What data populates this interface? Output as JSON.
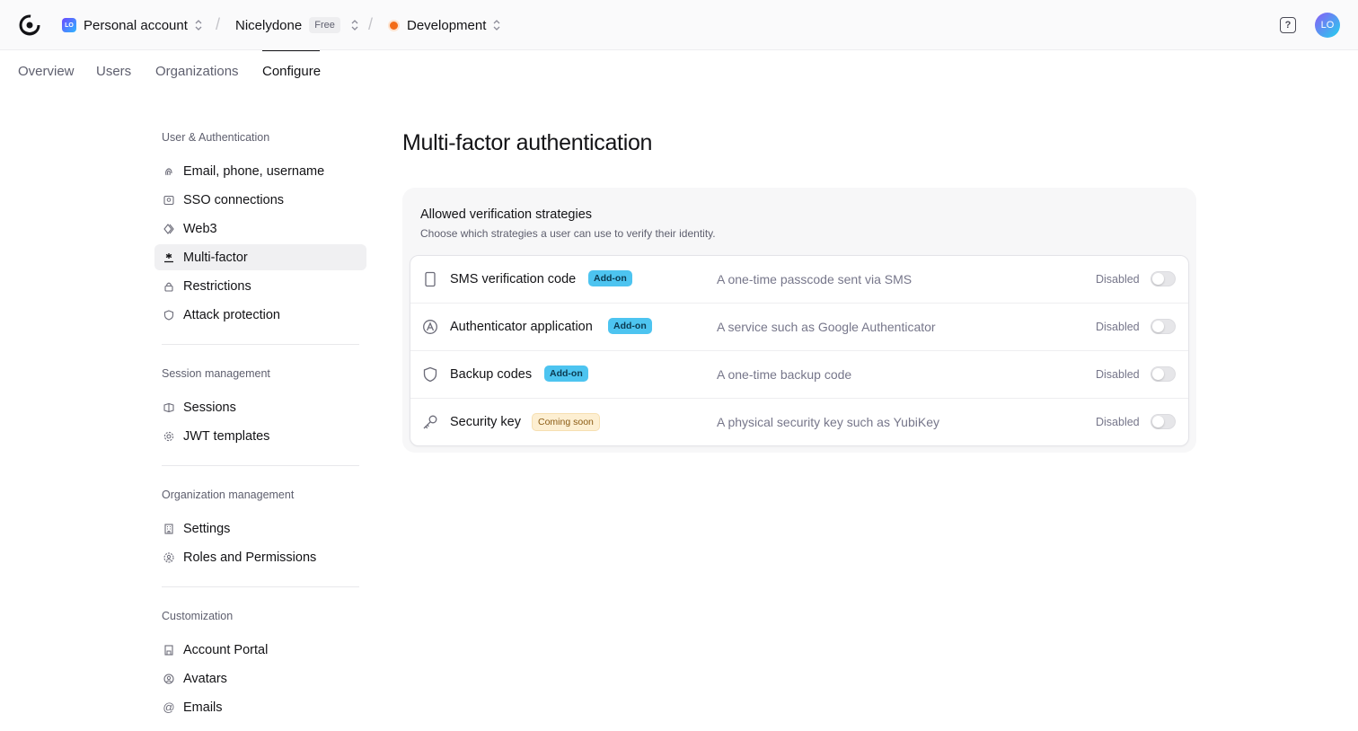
{
  "header": {
    "account": {
      "avatar_text": "LO",
      "label": "Personal account"
    },
    "app": {
      "label": "Nicelydone",
      "plan_badge": "Free"
    },
    "instance": {
      "label": "Development"
    },
    "help_icon": "question-icon",
    "user_avatar": "LO"
  },
  "tabs": [
    {
      "label": "Overview",
      "active": false
    },
    {
      "label": "Users",
      "active": false
    },
    {
      "label": "Organizations",
      "active": false
    },
    {
      "label": "Configure",
      "active": true
    }
  ],
  "sidebar": {
    "sections": [
      {
        "title": "User & Authentication",
        "items": [
          {
            "label": "Email, phone, username",
            "icon": "fingerprint-icon",
            "active": false
          },
          {
            "label": "SSO connections",
            "icon": "sso-icon",
            "active": false
          },
          {
            "label": "Web3",
            "icon": "web3-icon",
            "active": false
          },
          {
            "label": "Multi-factor",
            "icon": "asterisk-icon",
            "active": true
          },
          {
            "label": "Restrictions",
            "icon": "lock-icon",
            "active": false
          },
          {
            "label": "Attack protection",
            "icon": "shield-icon",
            "active": false
          }
        ]
      },
      {
        "title": "Session management",
        "items": [
          {
            "label": "Sessions",
            "icon": "session-icon",
            "active": false
          },
          {
            "label": "JWT templates",
            "icon": "gear-icon",
            "active": false
          }
        ]
      },
      {
        "title": "Organization management",
        "items": [
          {
            "label": "Settings",
            "icon": "building-icon",
            "active": false
          },
          {
            "label": "Roles and Permissions",
            "icon": "roles-icon",
            "active": false
          }
        ]
      },
      {
        "title": "Customization",
        "items": [
          {
            "label": "Account Portal",
            "icon": "portal-icon",
            "active": false
          },
          {
            "label": "Avatars",
            "icon": "avatar-icon",
            "active": false
          },
          {
            "label": "Emails",
            "icon": "at-icon",
            "active": false
          }
        ]
      }
    ]
  },
  "main": {
    "title": "Multi-factor authentication",
    "card": {
      "title": "Allowed verification strategies",
      "subtitle": "Choose which strategies a user can use to verify their identity.",
      "strategies": [
        {
          "name": "SMS verification code",
          "badge": "Add-on",
          "badge_type": "addon",
          "description": "A one-time passcode sent via SMS",
          "status": "Disabled",
          "enabled": false,
          "icon": "phone-icon"
        },
        {
          "name": "Authenticator application",
          "badge": "Add-on",
          "badge_type": "addon",
          "description": "A service such as Google Authenticator",
          "status": "Disabled",
          "enabled": false,
          "icon": "authenticator-icon"
        },
        {
          "name": "Backup codes",
          "badge": "Add-on",
          "badge_type": "addon",
          "description": "A one-time backup code",
          "status": "Disabled",
          "enabled": false,
          "icon": "shield-icon"
        },
        {
          "name": "Security key",
          "badge": "Coming soon",
          "badge_type": "soon",
          "description": "A physical security key such as YubiKey",
          "status": "Disabled",
          "enabled": false,
          "icon": "key-icon"
        }
      ]
    }
  },
  "colors": {
    "accent_badge": "#4dc4f0",
    "dev_dot": "#f36b16",
    "text": "#131316",
    "muted": "#5e5f6e"
  }
}
